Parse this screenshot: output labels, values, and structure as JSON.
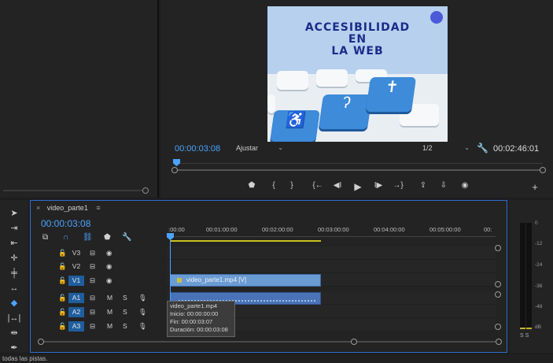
{
  "program": {
    "current_time": "00:00:03:08",
    "duration": "00:02:46:01",
    "zoom_label": "Ajustar",
    "resolution_label": "1/2",
    "video_title_lines": [
      "ACCESIBILIDAD",
      "EN",
      "LA WEB"
    ]
  },
  "transport": {
    "marker": "⬟",
    "in": "{",
    "out": "}",
    "goto_in": "{←",
    "step_back": "◀I",
    "play": "▶",
    "step_fwd": "I▶",
    "goto_out": "→}",
    "lift": "⇪",
    "extract": "⇩",
    "camera": "◉",
    "add": "+"
  },
  "timeline": {
    "sequence_name": "video_parte1",
    "menu_icon": "≡",
    "close_icon": "×",
    "current_time": "00:00:03:08",
    "ruler_labels": [
      ":00:00",
      "00:01:00:00",
      "00:02:00:00",
      "00:03:00:00",
      "00:04:00:00",
      "00:05:00:00",
      "00:"
    ],
    "tracks": [
      {
        "name": "V3",
        "type": "video"
      },
      {
        "name": "V2",
        "type": "video"
      },
      {
        "name": "V1",
        "type": "video"
      },
      {
        "name": "A1",
        "type": "audio"
      },
      {
        "name": "A2",
        "type": "audio"
      },
      {
        "name": "A3",
        "type": "audio"
      }
    ],
    "track_m": "M",
    "track_s": "S",
    "clip_video_label": "video_parte1.mp4 [V]",
    "tooltip": {
      "name": "video_parte1.mp4",
      "inicio": "Inicio: 00:00:00:00",
      "fin": "Fin: 00:00:03:07",
      "duracion": "Duración: 00:00:03:08"
    }
  },
  "meter": {
    "db_labels": [
      "0",
      "-12",
      "-24",
      "-36",
      "-48",
      "dB"
    ],
    "solo_labels": "S S"
  },
  "status": {
    "text": "todas las pistas."
  },
  "colors": {
    "accent_blue": "#4aa3ff",
    "clip_video": "#6a9bd3",
    "clip_audio": "#4a73b7",
    "work_area": "#c8c21c",
    "video_bg": "#b6d0ee",
    "title_color": "#1c2b8a"
  }
}
